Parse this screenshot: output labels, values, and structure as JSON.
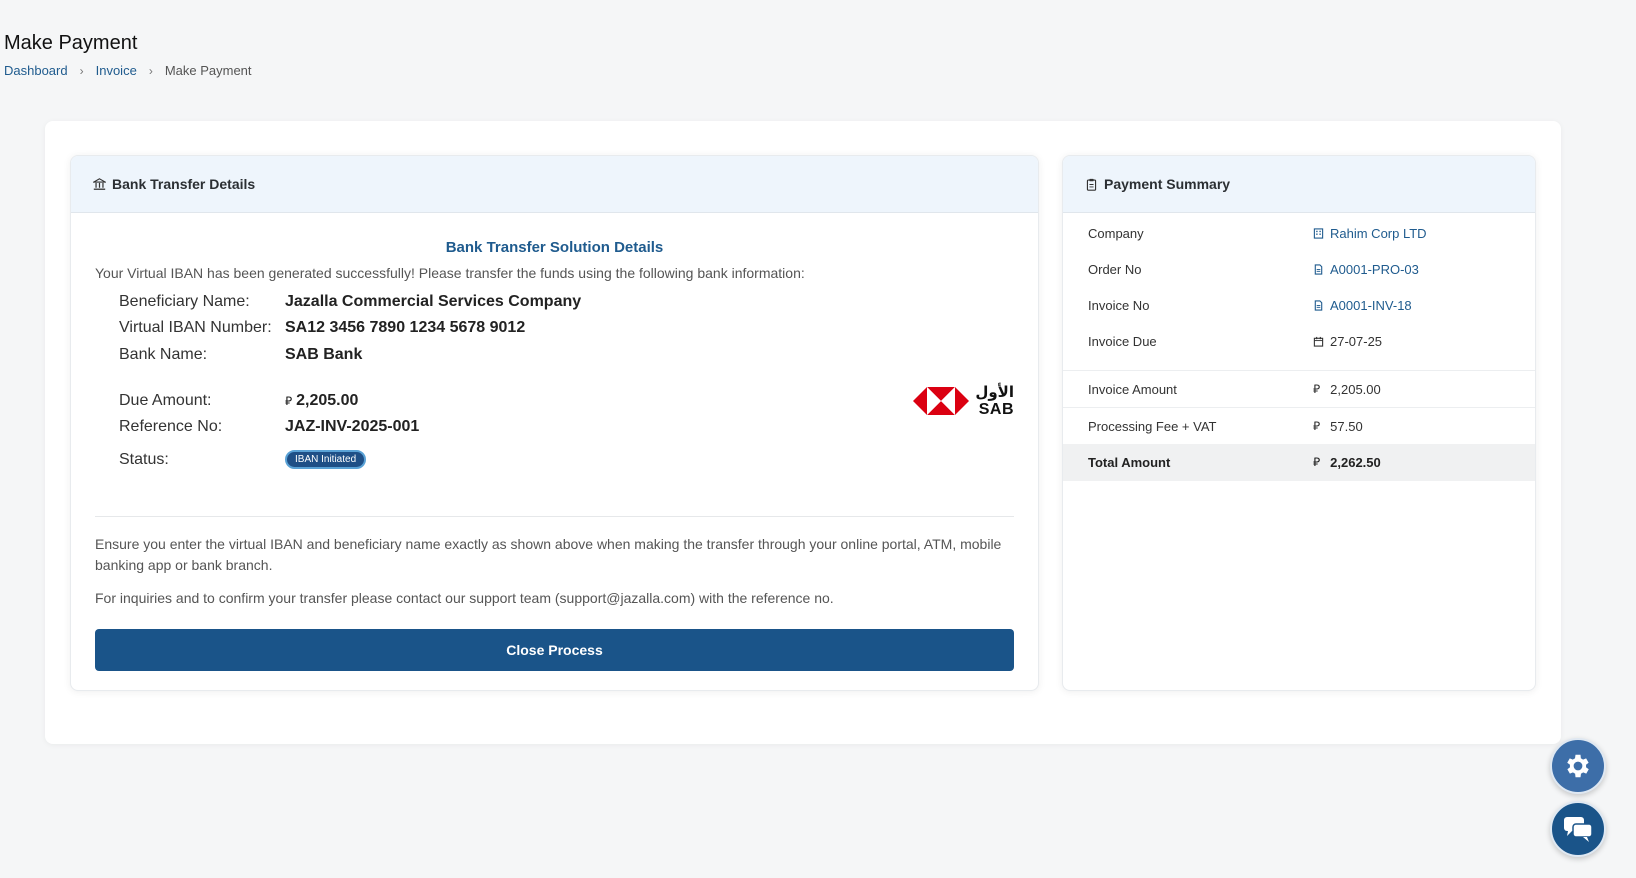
{
  "page": {
    "title": "Make Payment",
    "breadcrumb": [
      "Dashboard",
      "Invoice",
      "Make Payment"
    ]
  },
  "bank_panel": {
    "header": "Bank Transfer Details",
    "solution_title": "Bank Transfer Solution Details",
    "intro": "Your Virtual IBAN has been generated successfully! Please transfer the funds using the following bank information:",
    "beneficiary_label": "Beneficiary Name:",
    "beneficiary_value": "Jazalla Commercial Services Company",
    "iban_label": "Virtual IBAN Number:",
    "iban_value": "SA12 3456 7890 1234 5678 9012",
    "bank_label": "Bank Name:",
    "bank_value": "SAB Bank",
    "due_label": "Due Amount:",
    "due_value": "2,205.00",
    "reference_label": "Reference No:",
    "reference_value": "JAZ-INV-2025-001",
    "status_label": "Status:",
    "status_value": "IBAN Initiated",
    "logo_arabic": "الأول",
    "logo_latin": "SAB",
    "note1": "Ensure you enter the virtual IBAN and beneficiary name exactly as shown above when making the transfer through your online portal, ATM, mobile banking app or bank branch.",
    "note2": "For inquiries and to confirm your transfer please contact our support team (support@jazalla.com) with the reference no.",
    "close_button": "Close Process"
  },
  "summary_panel": {
    "header": "Payment Summary",
    "company_label": "Company",
    "company_value": "Rahim Corp LTD",
    "order_label": "Order No",
    "order_value": "A0001-PRO-03",
    "invoice_label": "Invoice No",
    "invoice_value": "A0001-INV-18",
    "due_label": "Invoice Due",
    "due_value": "27-07-25",
    "amount_label": "Invoice Amount",
    "amount_value": "2,205.00",
    "fee_label": "Processing Fee + VAT",
    "fee_value": "57.50",
    "total_label": "Total Amount",
    "total_value": "2,262.50"
  },
  "icons": {
    "currency": "riyal-icon",
    "settings": "gear-icon",
    "chat": "chat-icon"
  },
  "colors": {
    "primary": "#1a5489",
    "link": "#1f5b8e",
    "header_bg": "#eef5fc",
    "brand_red": "#db0011"
  }
}
